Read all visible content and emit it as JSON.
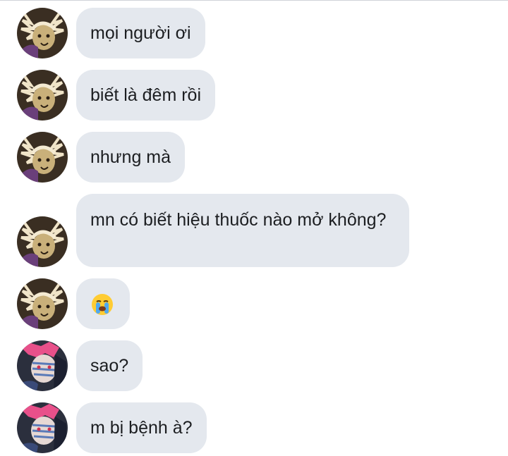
{
  "messages": [
    {
      "sender": "user-a",
      "text": "mọi người ơi"
    },
    {
      "sender": "user-a",
      "text": "biết là đêm rồi"
    },
    {
      "sender": "user-a",
      "text": "nhưng mà"
    },
    {
      "sender": "user-a",
      "text": "mn có biết hiệu thuốc nào mở không?"
    },
    {
      "sender": "user-a",
      "emoji": "loudly-crying-face-icon"
    },
    {
      "sender": "user-b",
      "text": "sao?"
    },
    {
      "sender": "user-b",
      "text": "m bị bệnh à?"
    }
  ],
  "colors": {
    "bubble": "#e4e8ee",
    "text": "#1c1e21",
    "avatar_a_bg": "#3a2e22",
    "avatar_a_hair": "#f0e4c8",
    "avatar_b_bg": "#2b2f3d",
    "avatar_b_hair": "#e8508a"
  }
}
